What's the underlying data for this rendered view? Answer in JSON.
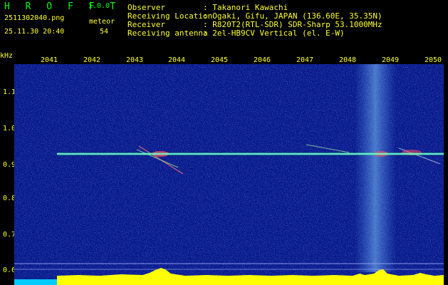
{
  "header": {
    "app_name": "H R O F F T",
    "version": "1.0.0",
    "filename": "2511302040.png",
    "meteor_label": "meteor",
    "timestamp": "25.11.30 20:40",
    "meteor_count": "54",
    "info": [
      {
        "key": "Observer",
        "value": ": Takanori Kawachi"
      },
      {
        "key": "Receiving Location",
        "value": ": Ogaki, Gifu, JAPAN (136.60E, 35.35N)"
      },
      {
        "key": "Receiver",
        "value": ": R820T2(RTL-SDR) SDR-Sharp 53.1000MHz"
      },
      {
        "key": "Receiving antenna",
        "value": ": 2el-HB9CV Vertical (el. E-W)"
      }
    ]
  },
  "spectrogram": {
    "unit_label": "kHz",
    "time_ticks": [
      "2041",
      "2042",
      "2043",
      "2044",
      "2045",
      "2046",
      "2047",
      "2048",
      "2049",
      "2050"
    ],
    "freq_ticks": [
      "1.1",
      "1.0",
      "0.9",
      "0.8",
      "0.7",
      "0.6"
    ],
    "carrier_freq_khz": 0.925,
    "colors": {
      "background": "#0a1a8a",
      "header_text": "#ffff33",
      "title": "#00ff00",
      "level_bar": "#ffff00",
      "level_bar_low": "#00ccff"
    }
  }
}
